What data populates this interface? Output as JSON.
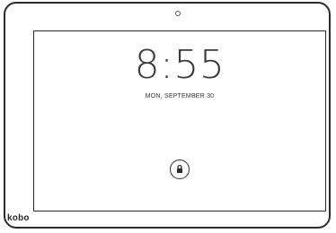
{
  "device": {
    "brand": "kobo"
  },
  "lockscreen": {
    "time": "8:55",
    "date": "MON, SEPTEMBER 30",
    "unlock_icon": "lock-icon"
  },
  "colors": {
    "frame": "#2b2b2b",
    "background": "#ffffff",
    "text": "#3a3a3a"
  }
}
